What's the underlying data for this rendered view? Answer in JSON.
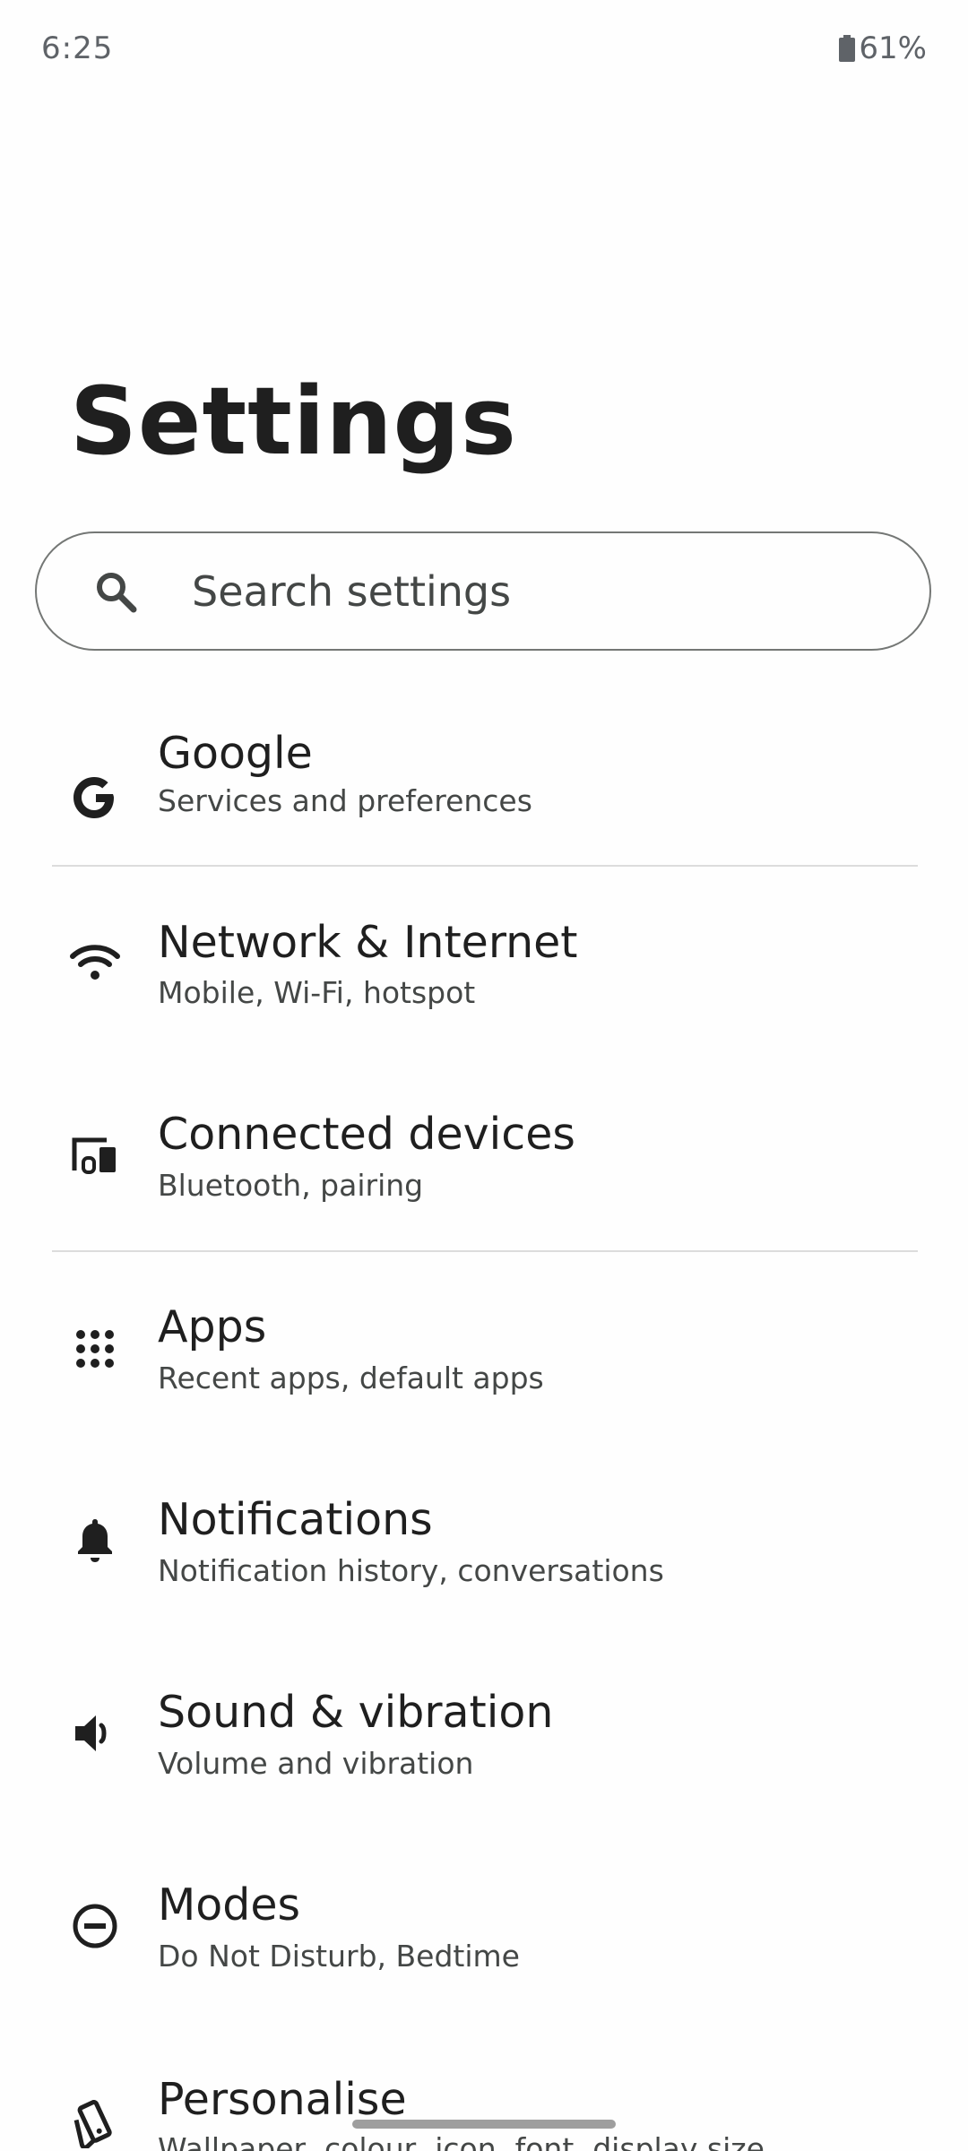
{
  "status_bar": {
    "time": "6:25",
    "battery_percent": "61%",
    "battery_icon": "battery-icon"
  },
  "header": {
    "title": "Settings"
  },
  "search": {
    "placeholder": "Search settings",
    "icon": "search-icon"
  },
  "items": [
    {
      "title": "Google",
      "subtitle": "Services and preferences",
      "icon": "google-icon"
    },
    {
      "title": "Network & Internet",
      "subtitle": "Mobile, Wi-Fi, hotspot",
      "icon": "wifi-icon"
    },
    {
      "title": "Connected devices",
      "subtitle": "Bluetooth, pairing",
      "icon": "devices-icon"
    },
    {
      "title": "Apps",
      "subtitle": "Recent apps, default apps",
      "icon": "apps-grid-icon"
    },
    {
      "title": "Notifications",
      "subtitle": "Notification history, conversations",
      "icon": "bell-icon"
    },
    {
      "title": "Sound & vibration",
      "subtitle": "Volume and vibration",
      "icon": "speaker-icon"
    },
    {
      "title": "Modes",
      "subtitle": "Do Not Disturb, Bedtime",
      "icon": "do-not-disturb-icon"
    },
    {
      "title": "Personalise",
      "subtitle": "Wallpaper, colour, icon, font, display size",
      "icon": "palette-icon"
    }
  ],
  "colors": {
    "text_primary": "#1f1f1f",
    "text_secondary": "#444746",
    "divider": "#dcdcdc",
    "background": "#fefefe"
  }
}
